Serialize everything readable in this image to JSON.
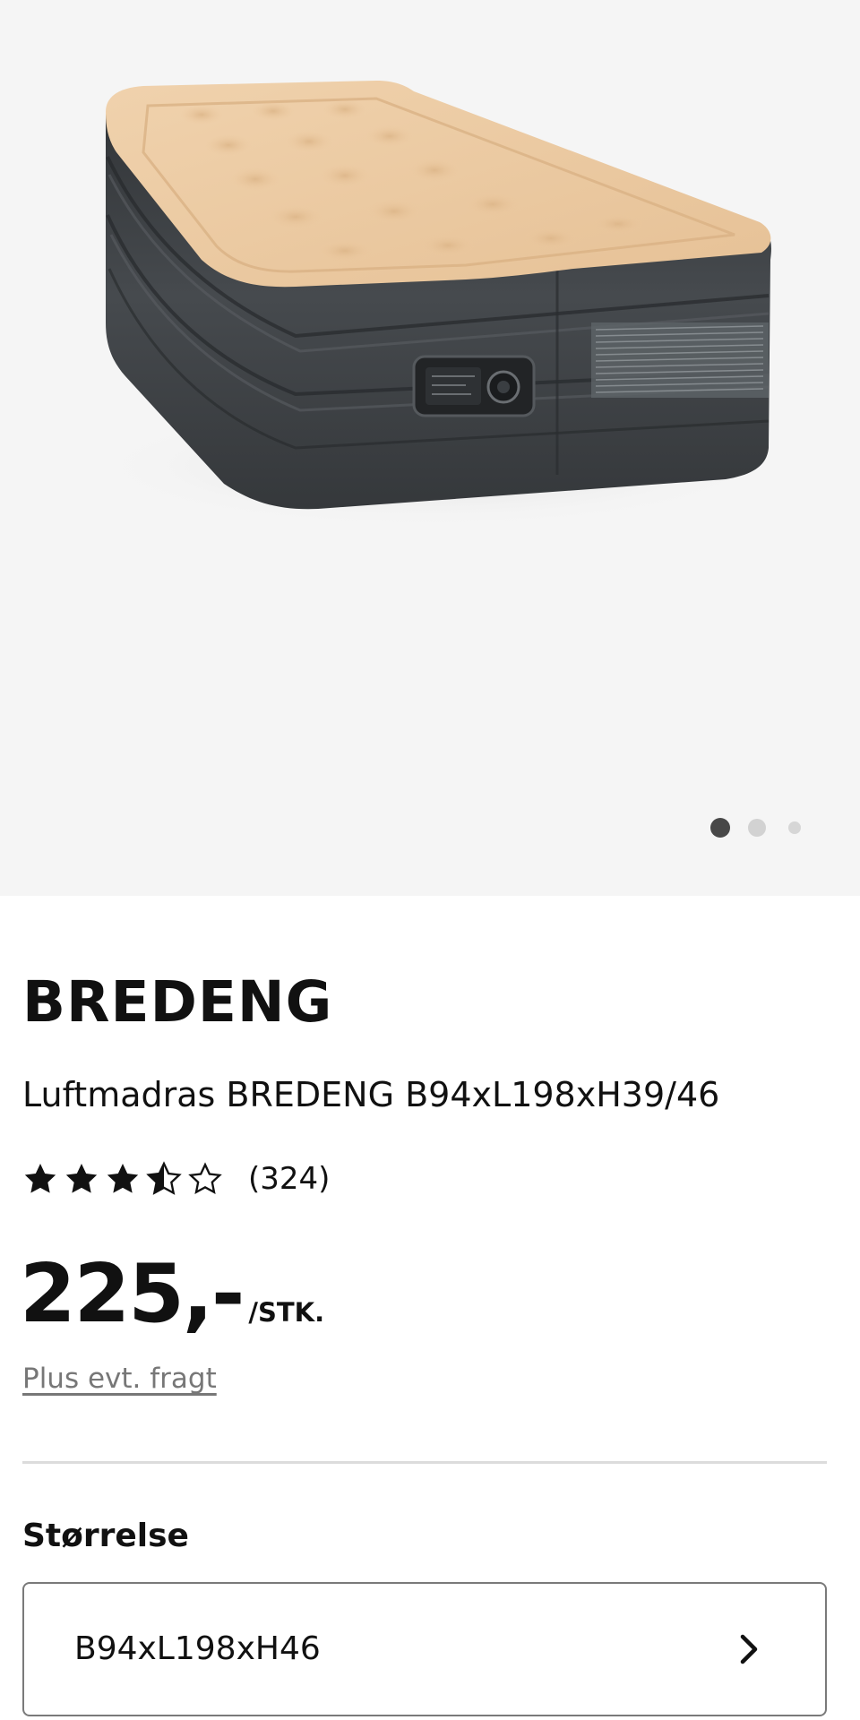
{
  "gallery": {
    "image_name": "air-mattress-product-photo",
    "slide_count": 3,
    "active_slide": 1
  },
  "product": {
    "brand": "BREDENG",
    "title": "Luftmadras BREDENG B94xL198xH39/46",
    "rating": {
      "stars": 3.5,
      "max_stars": 5,
      "count_text": "(324)"
    },
    "price": "225,-",
    "price_unit": "/STK.",
    "shipping_link": "Plus evt. fragt"
  },
  "size": {
    "label": "Størrelse",
    "selected": "B94xL198xH46",
    "chevron_icon": "chevron-right-icon"
  },
  "colors": {
    "gallery_bg": "#f5f5f5",
    "mattress_top": "#ecc9a0",
    "mattress_side": "#3b3e41",
    "dot_active": "#484848",
    "dot_inactive": "#d2d2d2",
    "link_gray": "#777777"
  }
}
